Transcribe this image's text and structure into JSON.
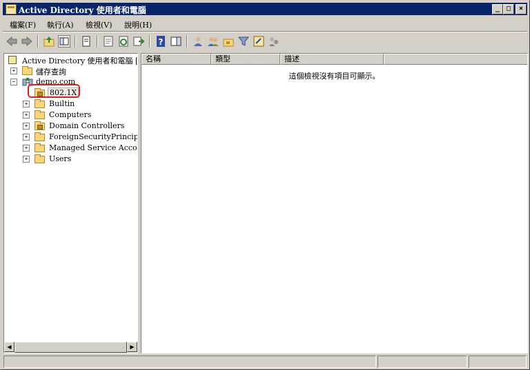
{
  "window": {
    "title": "Active Directory 使用者和電腦",
    "buttons": {
      "minimize": "_",
      "maximize": "□",
      "close": "×"
    }
  },
  "menu": [
    "檔案(F)",
    "執行(A)",
    "檢視(V)",
    "說明(H)"
  ],
  "toolbar": {
    "icons": [
      "back-icon",
      "forward-icon",
      "up-icon",
      "show-hide-tree-icon",
      "copy-icon",
      "properties-icon",
      "refresh-icon",
      "export-list-icon",
      "help-icon",
      "show-hide-action-pane-icon",
      "new-user-icon",
      "new-group-icon",
      "new-ou-icon",
      "filter-icon",
      "find-icon",
      "add-to-group-icon"
    ]
  },
  "tree": {
    "root": "Active Directory 使用者和電腦 [A:",
    "saved_queries": "儲存查詢",
    "domain": "demo.com",
    "children": [
      "802.1X",
      "Builtin",
      "Computers",
      "Domain Controllers",
      "ForeignSecurityPrincipals",
      "Managed Service Accounts",
      "Users"
    ]
  },
  "list": {
    "columns": [
      "名稱",
      "類型",
      "描述"
    ],
    "empty_message": "這個檢視沒有項目可顯示。"
  },
  "colors": {
    "titlebar": "#0a246a",
    "highlight_box": "#e02020",
    "window_face": "#d4d0c8"
  }
}
